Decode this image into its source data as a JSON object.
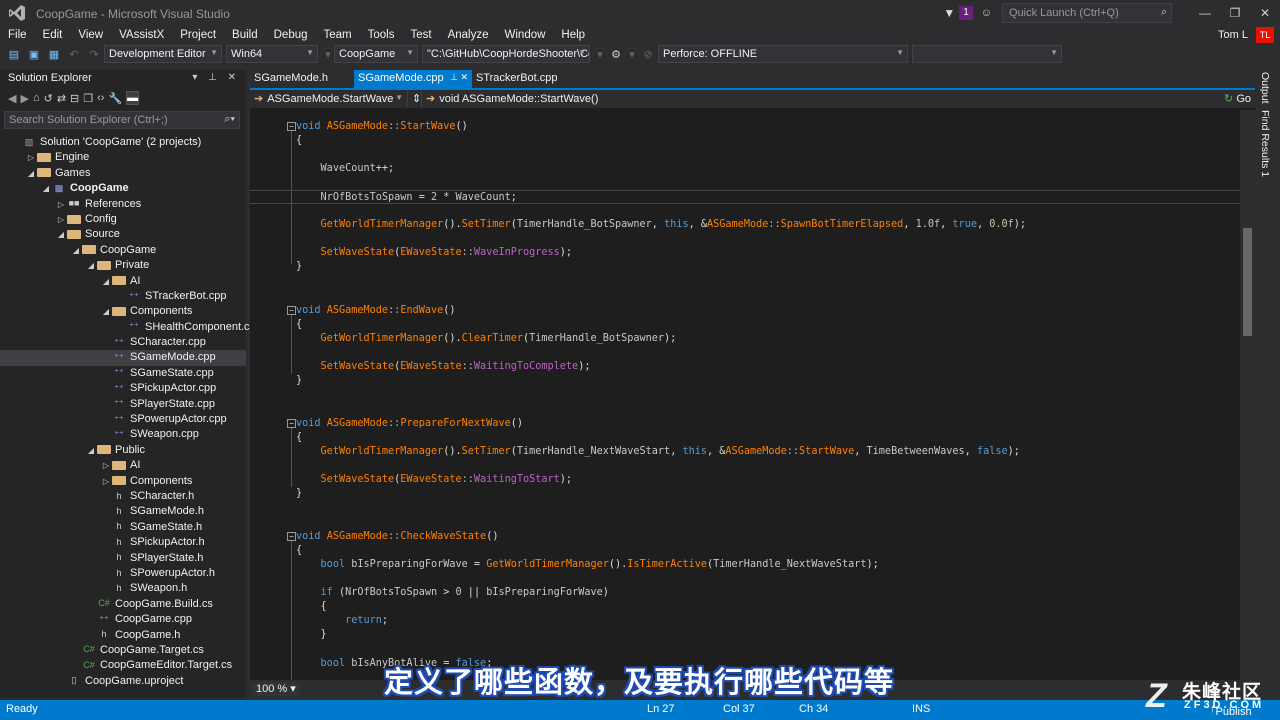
{
  "window": {
    "title": "CoopGame - Microsoft Visual Studio",
    "notification_count": "1",
    "quick_launch_placeholder": "Quick Launch (Ctrl+Q)",
    "user_name": "Tom L",
    "user_initials": "TL"
  },
  "menu": [
    "File",
    "Edit",
    "View",
    "VAssistX",
    "Project",
    "Build",
    "Debug",
    "Team",
    "Tools",
    "Test",
    "Analyze",
    "Window",
    "Help"
  ],
  "toolbar": {
    "configuration": "Development Editor",
    "platform": "Win64",
    "startup_project": "CoopGame",
    "command_args": "\"C:\\GitHub\\CoopHordeShooter\\Co",
    "perforce": "Perforce: OFFLINE"
  },
  "solution_explorer": {
    "title": "Solution Explorer",
    "search_placeholder": "Search Solution Explorer (Ctrl+;)",
    "items": [
      {
        "label": "Solution 'CoopGame' (2 projects)",
        "depth": 0,
        "arrow": "",
        "icon": "sol"
      },
      {
        "label": "Engine",
        "depth": 1,
        "arrow": "▷",
        "icon": "folder"
      },
      {
        "label": "Games",
        "depth": 1,
        "arrow": "◢",
        "icon": "folder"
      },
      {
        "label": "CoopGame",
        "depth": 2,
        "arrow": "◢",
        "icon": "proj",
        "bold": true
      },
      {
        "label": "References",
        "depth": 3,
        "arrow": "▷",
        "icon": "ref"
      },
      {
        "label": "Config",
        "depth": 3,
        "arrow": "▷",
        "icon": "folder"
      },
      {
        "label": "Source",
        "depth": 3,
        "arrow": "◢",
        "icon": "folder"
      },
      {
        "label": "CoopGame",
        "depth": 4,
        "arrow": "◢",
        "icon": "folder"
      },
      {
        "label": "Private",
        "depth": 5,
        "arrow": "◢",
        "icon": "folder"
      },
      {
        "label": "AI",
        "depth": 6,
        "arrow": "◢",
        "icon": "folder"
      },
      {
        "label": "STrackerBot.cpp",
        "depth": 7,
        "arrow": "",
        "icon": "cpp"
      },
      {
        "label": "Components",
        "depth": 6,
        "arrow": "◢",
        "icon": "folder"
      },
      {
        "label": "SHealthComponent.cpp",
        "depth": 7,
        "arrow": "",
        "icon": "cpp"
      },
      {
        "label": "SCharacter.cpp",
        "depth": 6,
        "arrow": "",
        "icon": "cpp"
      },
      {
        "label": "SGameMode.cpp",
        "depth": 6,
        "arrow": "",
        "icon": "cpp",
        "selected": true
      },
      {
        "label": "SGameState.cpp",
        "depth": 6,
        "arrow": "",
        "icon": "cpp"
      },
      {
        "label": "SPickupActor.cpp",
        "depth": 6,
        "arrow": "",
        "icon": "cpp"
      },
      {
        "label": "SPlayerState.cpp",
        "depth": 6,
        "arrow": "",
        "icon": "cpp"
      },
      {
        "label": "SPowerupActor.cpp",
        "depth": 6,
        "arrow": "",
        "icon": "cpp"
      },
      {
        "label": "SWeapon.cpp",
        "depth": 6,
        "arrow": "",
        "icon": "cpp"
      },
      {
        "label": "Public",
        "depth": 5,
        "arrow": "◢",
        "icon": "folder"
      },
      {
        "label": "AI",
        "depth": 6,
        "arrow": "▷",
        "icon": "folder"
      },
      {
        "label": "Components",
        "depth": 6,
        "arrow": "▷",
        "icon": "folder"
      },
      {
        "label": "SCharacter.h",
        "depth": 6,
        "arrow": "",
        "icon": "h"
      },
      {
        "label": "SGameMode.h",
        "depth": 6,
        "arrow": "",
        "icon": "h"
      },
      {
        "label": "SGameState.h",
        "depth": 6,
        "arrow": "",
        "icon": "h"
      },
      {
        "label": "SPickupActor.h",
        "depth": 6,
        "arrow": "",
        "icon": "h"
      },
      {
        "label": "SPlayerState.h",
        "depth": 6,
        "arrow": "",
        "icon": "h"
      },
      {
        "label": "SPowerupActor.h",
        "depth": 6,
        "arrow": "",
        "icon": "h"
      },
      {
        "label": "SWeapon.h",
        "depth": 6,
        "arrow": "",
        "icon": "h"
      },
      {
        "label": "CoopGame.Build.cs",
        "depth": 5,
        "arrow": "",
        "icon": "cs"
      },
      {
        "label": "CoopGame.cpp",
        "depth": 5,
        "arrow": "",
        "icon": "cpp"
      },
      {
        "label": "CoopGame.h",
        "depth": 5,
        "arrow": "",
        "icon": "h"
      },
      {
        "label": "CoopGame.Target.cs",
        "depth": 4,
        "arrow": "",
        "icon": "cs"
      },
      {
        "label": "CoopGameEditor.Target.cs",
        "depth": 4,
        "arrow": "",
        "icon": "cs"
      },
      {
        "label": "CoopGame.uproject",
        "depth": 3,
        "arrow": "",
        "icon": "file"
      }
    ]
  },
  "editor": {
    "tabs": [
      {
        "label": "SGameMode.h",
        "active": false
      },
      {
        "label": "SGameMode.cpp",
        "active": true
      },
      {
        "label": "STrackerBot.cpp",
        "active": false
      }
    ],
    "nav_scope": "ASGameMode.StartWave",
    "nav_function": "void ASGameMode::StartWave()",
    "nav_go": "Go",
    "zoom": "100 %"
  },
  "right_rail": [
    "Output",
    "Find Results 1"
  ],
  "status": {
    "state": "Ready",
    "line": "Ln 27",
    "col": "Col 37",
    "ch": "Ch 34",
    "mode": "INS",
    "publish": "Publish"
  },
  "subtitle": "定义了哪些函数，及要执行哪些代码等",
  "watermark": {
    "cn": "朱峰社区",
    "url": "ZF3D.COM"
  },
  "colors": {
    "accent": "#007acc",
    "background": "#1e1e1e",
    "chrome": "#2d2d30",
    "subtitle_outline": "#1e4bb0"
  }
}
